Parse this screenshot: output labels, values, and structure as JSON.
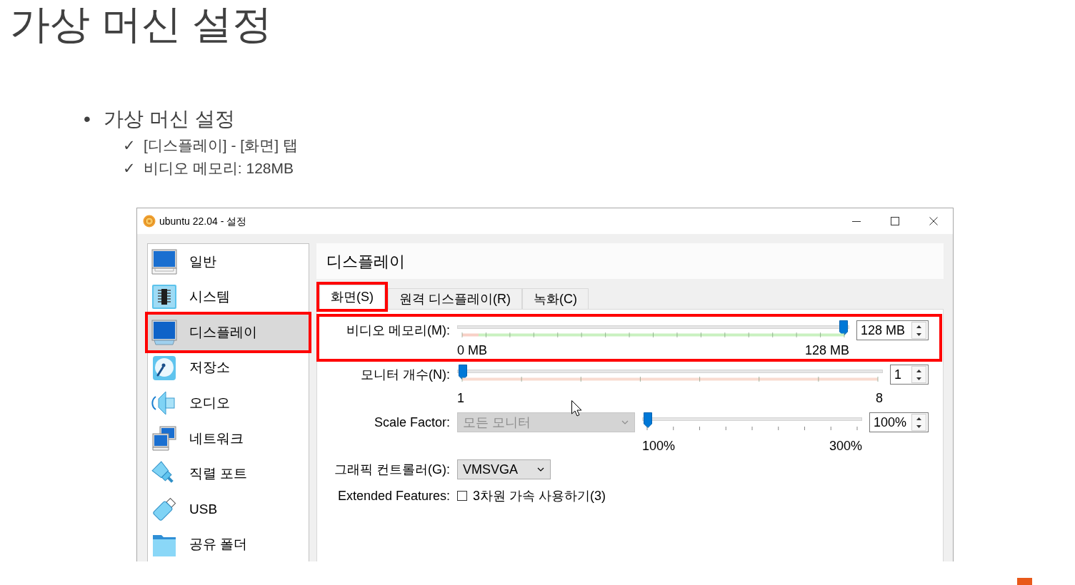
{
  "slide": {
    "title": "가상 머신 설정",
    "bullets": [
      {
        "marker": "•",
        "text": "가상 머신 설정",
        "children": [
          {
            "marker": "✓",
            "text": "[디스플레이] - [화면] 탭"
          },
          {
            "marker": "✓",
            "text": "비디오 메모리: 128MB"
          }
        ]
      }
    ]
  },
  "window": {
    "title": "ubuntu 22.04 - 설정"
  },
  "sidebar": {
    "items": [
      {
        "label": "일반",
        "selected": false,
        "highlighted": false
      },
      {
        "label": "시스템",
        "selected": false,
        "highlighted": false
      },
      {
        "label": "디스플레이",
        "selected": true,
        "highlighted": true
      },
      {
        "label": "저장소",
        "selected": false,
        "highlighted": false
      },
      {
        "label": "오디오",
        "selected": false,
        "highlighted": false
      },
      {
        "label": "네트워크",
        "selected": false,
        "highlighted": false
      },
      {
        "label": "직렬 포트",
        "selected": false,
        "highlighted": false
      },
      {
        "label": "USB",
        "selected": false,
        "highlighted": false
      },
      {
        "label": "공유 폴더",
        "selected": false,
        "highlighted": false
      }
    ]
  },
  "panel": {
    "title": "디스플레이",
    "tabs": [
      {
        "label": "화면(S)",
        "selected": true,
        "highlighted": true
      },
      {
        "label": "원격 디스플레이(R)",
        "selected": false,
        "highlighted": false
      },
      {
        "label": "녹화(C)",
        "selected": false,
        "highlighted": false
      }
    ],
    "rows": [
      {
        "kind": "slider",
        "label": "비디오 메모리(M):",
        "level": 1,
        "min_label": "0 MB",
        "max_label": "128 MB",
        "value": "128 MB",
        "highlighted": true
      },
      {
        "kind": "slider",
        "label": "모니터 개수(N):",
        "level": 0,
        "min_label": "1",
        "max_label": "8",
        "value": "1",
        "highlighted": false
      },
      {
        "kind": "select_slider",
        "label": "Scale Factor:",
        "select": {
          "value": "모든 모니터",
          "disabled": true
        },
        "level": 0,
        "min_label": "100%",
        "max_label": "300%",
        "value": "100%",
        "highlighted": false
      },
      {
        "kind": "select",
        "label": "그래픽 컨트롤러(G):",
        "value": "VMSVGA",
        "disabled": false,
        "highlighted": false
      },
      {
        "kind": "checkbox",
        "label": "Extended Features:",
        "option": "3차원 가속 사용하기(3)",
        "checked": false,
        "highlighted": false
      }
    ]
  }
}
